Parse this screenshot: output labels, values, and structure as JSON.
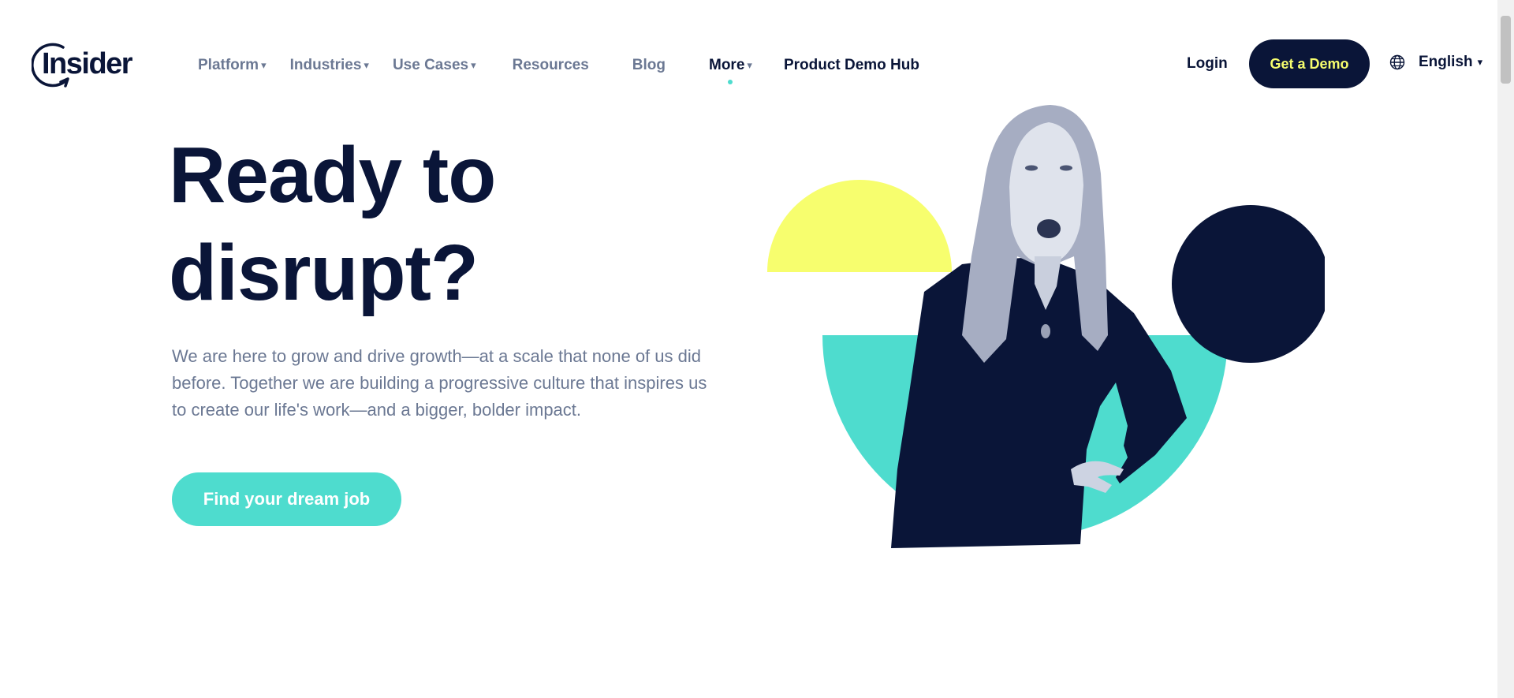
{
  "brand": {
    "logo_text": "Insider"
  },
  "nav": {
    "items": [
      {
        "label": "Platform",
        "caret": "▾"
      },
      {
        "label": "Industries",
        "caret": "▾"
      },
      {
        "label": "Use Cases",
        "caret": "▾"
      },
      {
        "label": "Resources"
      },
      {
        "label": "Blog"
      },
      {
        "label": "More",
        "caret": "▾",
        "active": true
      },
      {
        "label": "Product Demo Hub"
      }
    ]
  },
  "header": {
    "login_label": "Login",
    "demo_label": "Get a Demo",
    "language_label": "English",
    "language_icon": "globe-icon"
  },
  "hero": {
    "title_line1": "Ready to",
    "title_line2": "disrupt?",
    "body": "We are here to grow and drive growth—at a scale that none of us did before. Together we are building a progressive culture that inspires us to create our life's work—and a bigger, bolder impact.",
    "cta_label": "Find your dream job"
  },
  "colors": {
    "navy": "#0a1538",
    "teal": "#4edcce",
    "yellow": "#f7fe6e",
    "muted_text": "#6b7893"
  }
}
